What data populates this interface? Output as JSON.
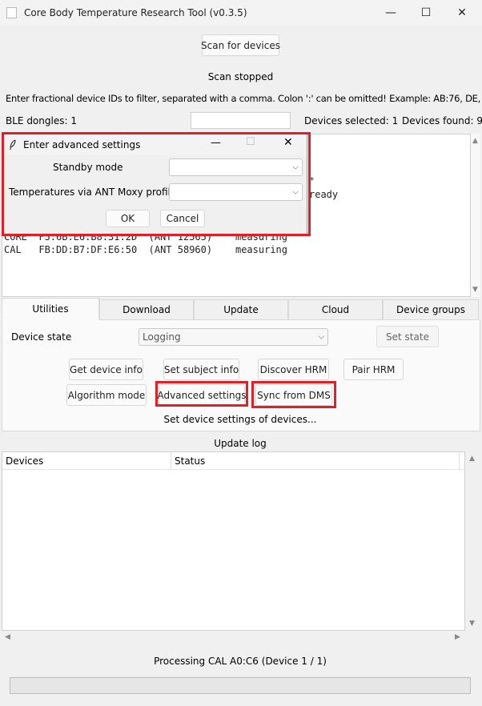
{
  "window": {
    "title": "Core Body Temperature Research Tool (v0.3.5)",
    "minimize_icon": "minimize-icon",
    "maximize_icon": "maximize-icon",
    "close_icon": "close-icon",
    "minimize_glyph": "—",
    "maximize_glyph": "☐",
    "close_glyph": "✕"
  },
  "scan": {
    "button_label": "Scan for devices",
    "status": "Scan stopped",
    "filter_hint": "Enter fractional device IDs to filter, separated with a comma. Colon ':' can be omitted! Example: AB:76, DE, bd12",
    "ble_dongles": "BLE dongles: 1",
    "filter_value": "",
    "devices_selected": "Devices selected: 1",
    "devices_found": "Devices found: 9"
  },
  "device_list": {
    "visible_fragments": [
      "*",
      "ready"
    ],
    "partial_row": "CORE  F5:6B:E6:B8:31:2D  (ANT 12565)    measuring",
    "rows": [
      "CAL   FB:DD:B7:DF:E6:50  (ANT 58960)    measuring"
    ]
  },
  "dialog": {
    "title": "Enter advanced settings",
    "app_icon": "feather-icon",
    "standby_label": "Standby mode",
    "standby_value": "",
    "moxy_label": "Temperatures via ANT Moxy profile",
    "moxy_value": "",
    "ok_label": "OK",
    "cancel_label": "Cancel"
  },
  "tabs": [
    "Utilities",
    "Download",
    "Update",
    "Cloud",
    "Device groups"
  ],
  "utilities": {
    "device_state_label": "Device state",
    "device_state_value": "Logging",
    "set_state_label": "Set state",
    "buttons_row1": [
      "Get device info",
      "Set subject info",
      "Discover HRM",
      "Pair HRM"
    ],
    "buttons_row2": [
      "Algorithm mode",
      "Advanced settings",
      "Sync from DMS"
    ],
    "status_text": "Set device settings of devices..."
  },
  "update_log": {
    "title": "Update log",
    "columns": [
      "Devices",
      "Status"
    ],
    "rows": []
  },
  "footer": {
    "processing": "Processing CAL A0:C6 (Device 1 / 1)",
    "progress": 0
  },
  "colors": {
    "highlight": "#e01f26",
    "background": "#f0f0f0"
  }
}
